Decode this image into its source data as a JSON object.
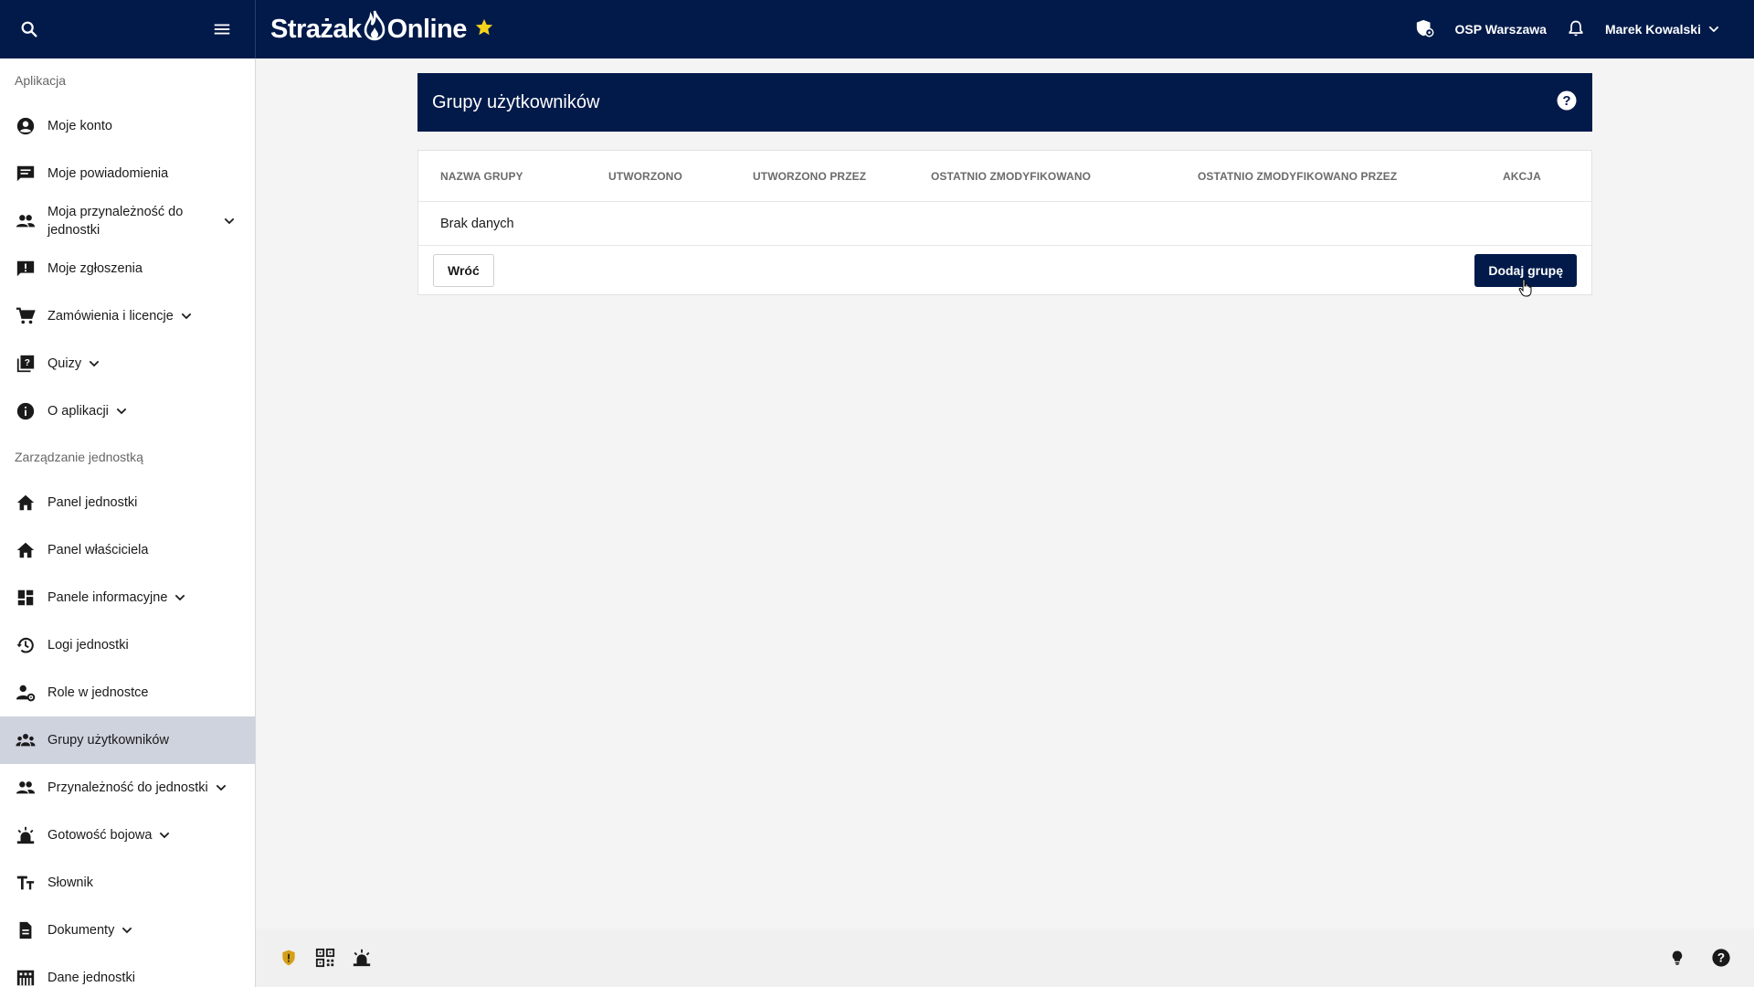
{
  "topbar": {
    "brand_left": "Strażak",
    "brand_right": "Online",
    "unit": "OSP Warszawa",
    "user": "Marek Kowalski"
  },
  "sidebar": {
    "section_app": "Aplikacja",
    "section_unit": "Zarządzanie jednostką",
    "app_items": [
      {
        "label": "Moje konto",
        "icon": "account-circle-icon"
      },
      {
        "label": "Moje powiadomienia",
        "icon": "chat-icon"
      },
      {
        "label": "Moja przynależność do jednostki",
        "icon": "people-icon"
      },
      {
        "label": "Moje zgłoszenia",
        "icon": "report-icon"
      },
      {
        "label": "Zamówienia i licencje",
        "icon": "cart-icon"
      },
      {
        "label": "Quizy",
        "icon": "quiz-icon"
      },
      {
        "label": "O aplikacji",
        "icon": "info-icon"
      }
    ],
    "unit_items": [
      {
        "label": "Panel jednostki",
        "icon": "home-icon"
      },
      {
        "label": "Panel właściciela",
        "icon": "home-icon"
      },
      {
        "label": "Panele informacyjne",
        "icon": "dashboard-icon"
      },
      {
        "label": "Logi jednostki",
        "icon": "history-icon"
      },
      {
        "label": "Role w jednostce",
        "icon": "person-settings-icon"
      },
      {
        "label": "Grupy użytkowników",
        "icon": "groups-icon"
      },
      {
        "label": "Przynależność do jednostki",
        "icon": "people-icon"
      },
      {
        "label": "Gotowość bojowa",
        "icon": "siren-icon"
      },
      {
        "label": "Słownik",
        "icon": "text-fields-icon"
      },
      {
        "label": "Dokumenty",
        "icon": "document-icon"
      },
      {
        "label": "Dane jednostki",
        "icon": "building-icon"
      }
    ]
  },
  "main": {
    "title": "Grupy użytkowników",
    "columns": [
      "NAZWA GRUPY",
      "UTWORZONO",
      "UTWORZONO PRZEZ",
      "OSTATNIO ZMODYFIKOWANO",
      "OSTATNIO ZMODYFIKOWANO PRZEZ",
      "AKCJA"
    ],
    "empty_text": "Brak danych",
    "back_button": "Wróć",
    "add_button": "Dodaj grupę"
  },
  "colors": {
    "navy": "#021a4a",
    "star": "#f5d31b",
    "active_item": "#cfd3de",
    "shield_badge": "#d4a017"
  }
}
